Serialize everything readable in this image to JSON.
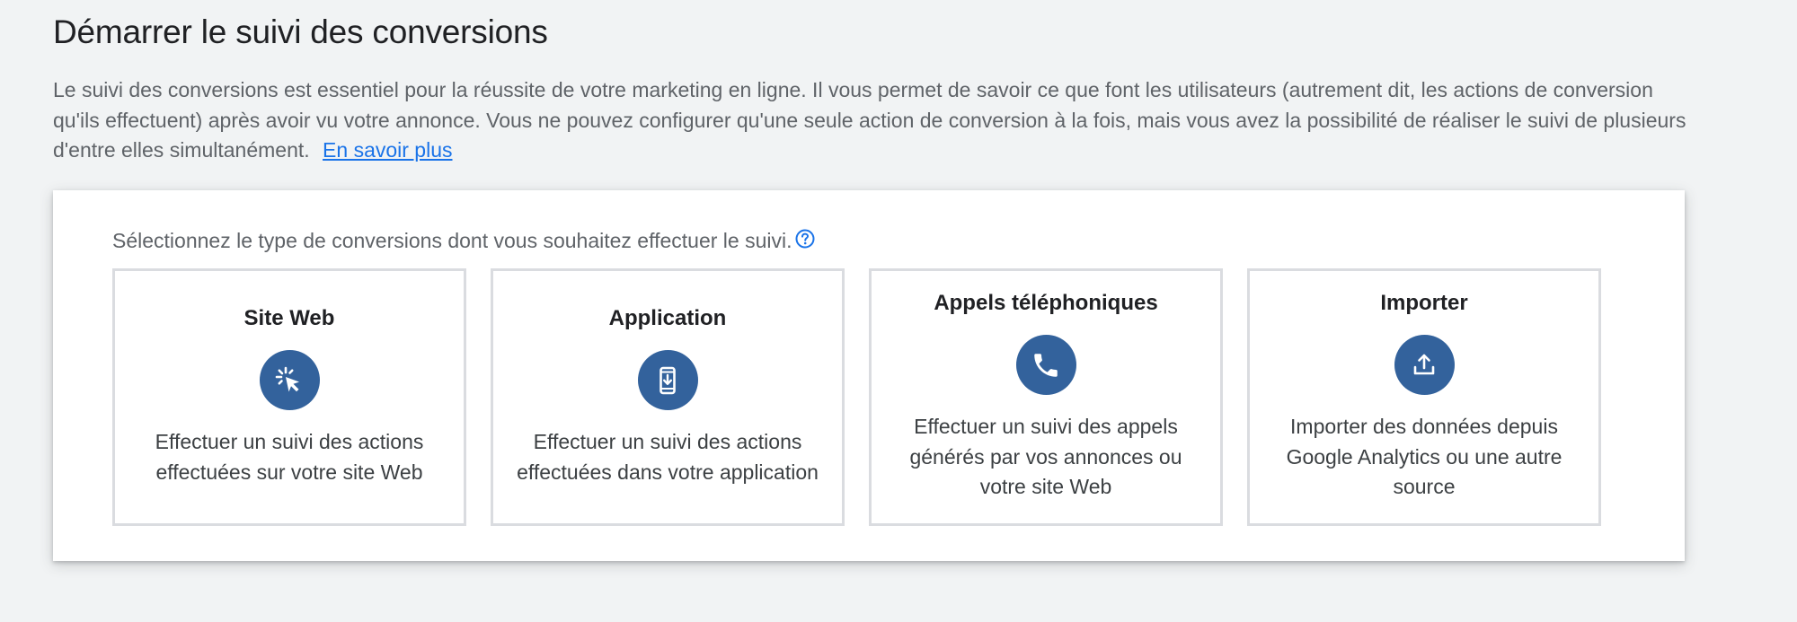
{
  "page": {
    "title": "Démarrer le suivi des conversions",
    "intro": "Le suivi des conversions est essentiel pour la réussite de votre marketing en ligne. Il vous permet de savoir ce que font les utilisateurs (autrement dit, les actions de conversion qu'ils effectuent) après avoir vu votre annonce. Vous ne pouvez configurer qu'une seule action de conversion à la fois, mais vous avez la possibilité de réaliser le suivi de plusieurs d'entre elles simultanément.",
    "learn_more": "En savoir plus"
  },
  "selector": {
    "prompt": "Sélectionnez le type de conversions dont vous souhaitez effectuer le suivi.",
    "help_icon": "help-circle-icon",
    "icon_color": "#33629c",
    "cards": [
      {
        "title": "Site Web",
        "icon": "click-cursor-icon",
        "description": "Effectuer un suivi des actions effectuées sur votre site Web"
      },
      {
        "title": "Application",
        "icon": "phone-download-icon",
        "description": "Effectuer un suivi des actions effectuées dans votre application"
      },
      {
        "title": "Appels téléphoniques",
        "icon": "phone-call-icon",
        "description": "Effectuer un suivi des appels générés par vos annonces ou votre site Web"
      },
      {
        "title": "Importer",
        "icon": "upload-icon",
        "description": "Importer des données depuis Google Analytics ou une autre source"
      }
    ]
  }
}
